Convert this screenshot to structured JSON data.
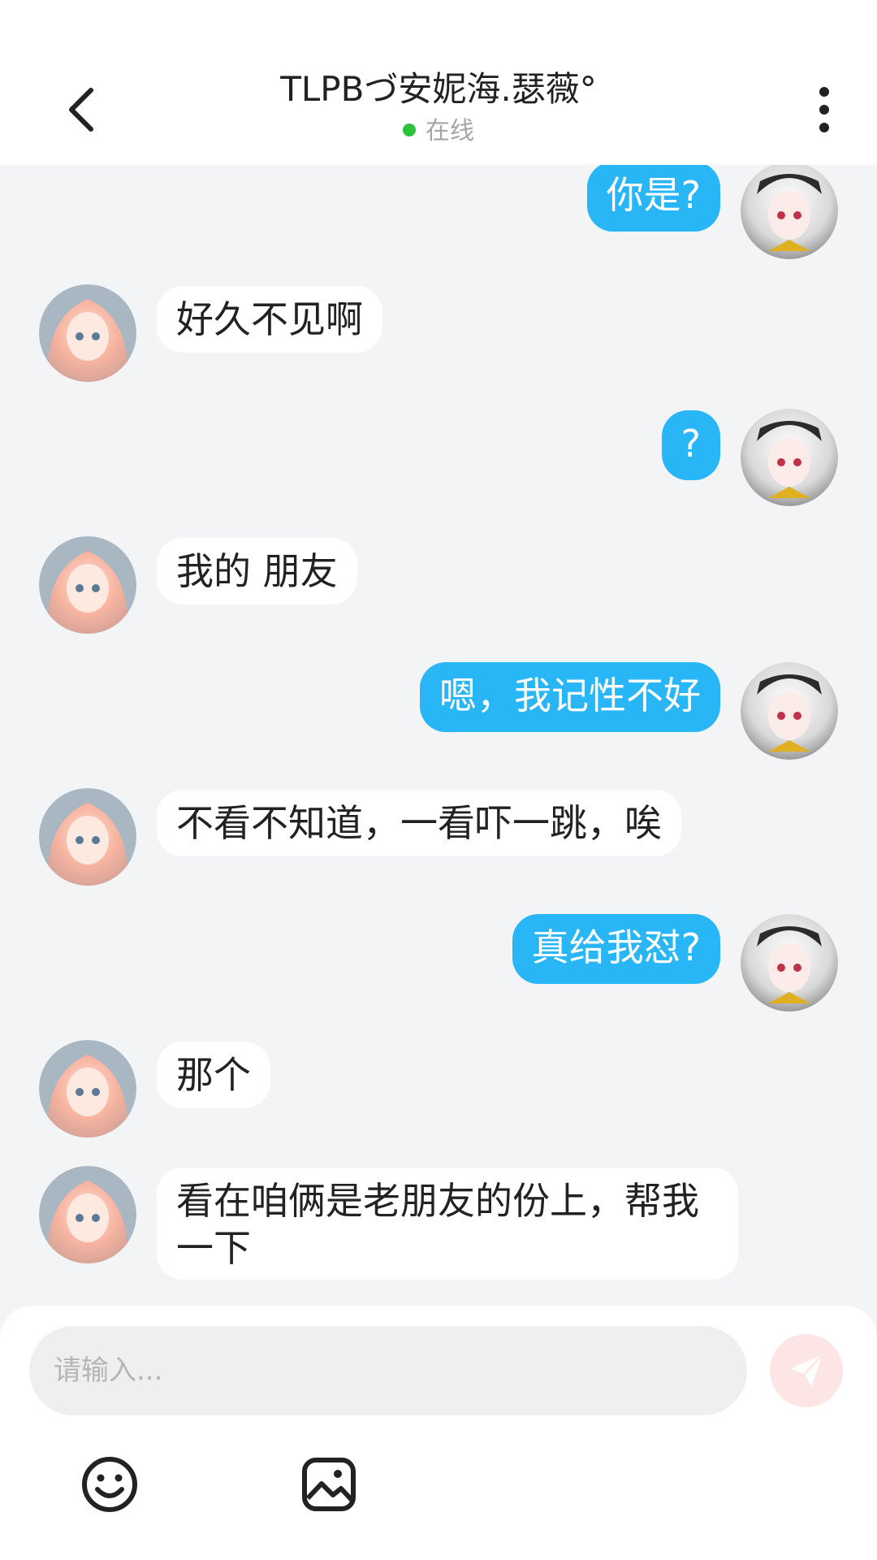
{
  "header": {
    "title": "TLPBづ安妮海.瑟薇°",
    "status": "在线"
  },
  "colors": {
    "outgoing_bubble": "#29b6f6",
    "online_dot": "#2fc33d",
    "status_indicator": "#f59a23"
  },
  "messages": [
    {
      "side": "out",
      "text": "你是?"
    },
    {
      "side": "in",
      "text": "好久不见啊"
    },
    {
      "side": "out",
      "text": "?"
    },
    {
      "side": "in",
      "text": "我的 朋友"
    },
    {
      "side": "out",
      "text": "嗯，我记性不好"
    },
    {
      "side": "in",
      "text": "不看不知道，一看吓一跳，唉"
    },
    {
      "side": "out",
      "text": "真给我怼?"
    },
    {
      "side": "in",
      "text": "那个"
    },
    {
      "side": "in",
      "text": "看在咱俩是老朋友的份上，帮我\n一下"
    }
  ],
  "input": {
    "placeholder": "请输入..."
  },
  "icons": {
    "back": "chevron-left-icon",
    "more": "more-vertical-icon",
    "send": "send-icon",
    "emoji": "emoji-icon",
    "image": "image-icon"
  }
}
